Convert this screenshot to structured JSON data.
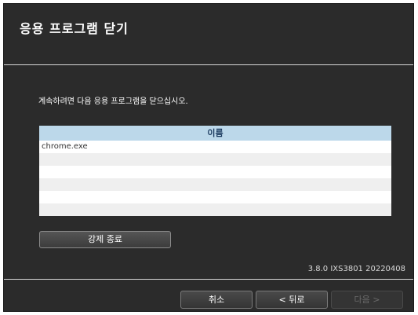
{
  "window": {
    "title": "응용 프로그램 닫기"
  },
  "instruction": "계속하려면 다음 응용 프로그램을 닫으십시오.",
  "table": {
    "header": "이름",
    "rows": [
      "chrome.exe",
      "",
      "",
      "",
      "",
      "",
      ""
    ]
  },
  "force_quit_label": "강제 종료",
  "version": "3.8.0 IXS3801 20220408",
  "buttons": {
    "cancel": "취소",
    "back": "< 뒤로",
    "next": "다음 >"
  }
}
